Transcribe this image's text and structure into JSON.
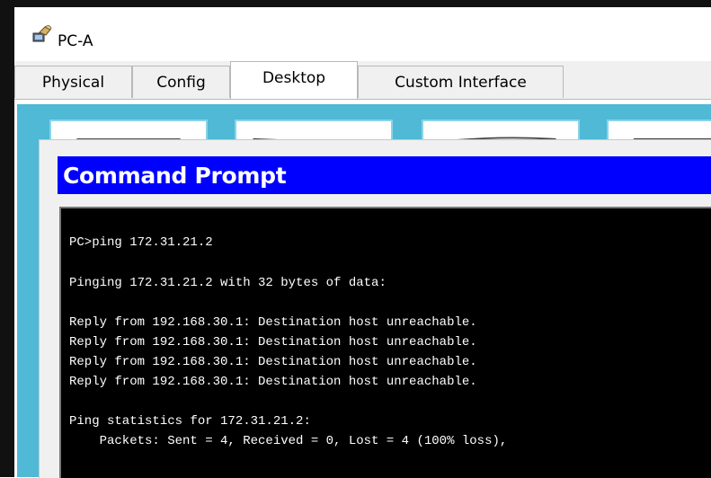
{
  "window": {
    "title": "PC-A",
    "icon": "pc-device-icon"
  },
  "tabs": [
    {
      "label": "Physical",
      "active": false
    },
    {
      "label": "Config",
      "active": false
    },
    {
      "label": "Desktop",
      "active": true
    },
    {
      "label": "Custom Interface",
      "active": false
    }
  ],
  "desktop": {
    "background_color": "#4fb9d6",
    "app_tiles": [
      "ip-configuration-icon",
      "dial-up-icon",
      "terminal-icon",
      "command-prompt-icon"
    ]
  },
  "command_prompt": {
    "title": "Command Prompt",
    "header_color": "#0000ff",
    "lines": [
      "PC>ping 172.31.21.2",
      "",
      "Pinging 172.31.21.2 with 32 bytes of data:",
      "",
      "Reply from 192.168.30.1: Destination host unreachable.",
      "Reply from 192.168.30.1: Destination host unreachable.",
      "Reply from 192.168.30.1: Destination host unreachable.",
      "Reply from 192.168.30.1: Destination host unreachable.",
      "",
      "Ping statistics for 172.31.21.2:",
      "    Packets: Sent = 4, Received = 0, Lost = 4 (100% loss),"
    ]
  }
}
